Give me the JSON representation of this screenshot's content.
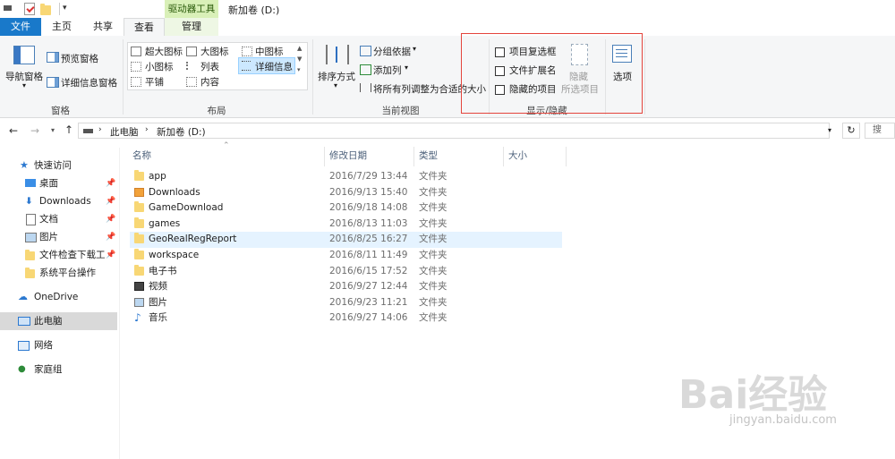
{
  "title_bar": {
    "context_tab_title": "驱动器工具",
    "window_title": "新加卷 (D:)"
  },
  "tabs": {
    "file": "文件",
    "home": "主页",
    "share": "共享",
    "view": "查看",
    "manage": "管理"
  },
  "ribbon": {
    "panes": {
      "nav_pane": "导航窗格",
      "preview_pane": "预览窗格",
      "details_pane": "详细信息窗格",
      "group_label": "窗格"
    },
    "layout": {
      "extra_large": "超大图标",
      "large": "大图标",
      "medium": "中图标",
      "small": "小图标",
      "list": "列表",
      "details": "详细信息",
      "tiles": "平铺",
      "content": "内容",
      "group_label": "布局"
    },
    "current_view": {
      "sort_by": "排序方式",
      "group_by": "分组依据",
      "add_columns": "添加列",
      "size_all_columns": "将所有列调整为合适的大小",
      "group_label": "当前视图"
    },
    "show_hide": {
      "item_checkboxes": "项目复选框",
      "file_extensions": "文件扩展名",
      "hidden_items": "隐藏的项目",
      "hide_selected_1": "隐藏",
      "hide_selected_2": "所选项目",
      "group_label": "显示/隐藏"
    },
    "options": "选项"
  },
  "address_bar": {
    "crumbs": [
      "此电脑",
      "新加卷 (D:)"
    ],
    "search_placeholder": "搜索\"新"
  },
  "nav_pane": {
    "quick_access": "快速访问",
    "pinned": [
      {
        "label": "桌面"
      },
      {
        "label": "Downloads"
      },
      {
        "label": "文档"
      },
      {
        "label": "图片"
      },
      {
        "label": "文件检查下载工具"
      },
      {
        "label": "系统平台操作"
      }
    ],
    "onedrive": "OneDrive",
    "this_pc": "此电脑",
    "network": "网络",
    "homegroup": "家庭组"
  },
  "columns": {
    "name": "名称",
    "date": "修改日期",
    "type": "类型",
    "size": "大小"
  },
  "files": [
    {
      "name": "app",
      "date": "2016/7/29 13:44",
      "type": "文件夹",
      "icon": "folder-icon"
    },
    {
      "name": "Downloads",
      "date": "2016/9/13 15:40",
      "type": "文件夹",
      "icon": "special-folder-icon"
    },
    {
      "name": "GameDownload",
      "date": "2016/9/18 14:08",
      "type": "文件夹",
      "icon": "folder-icon"
    },
    {
      "name": "games",
      "date": "2016/8/13 11:03",
      "type": "文件夹",
      "icon": "folder-icon"
    },
    {
      "name": "GeoRealRegReport",
      "date": "2016/8/25 16:27",
      "type": "文件夹",
      "icon": "folder-icon"
    },
    {
      "name": "workspace",
      "date": "2016/8/11 11:49",
      "type": "文件夹",
      "icon": "folder-icon"
    },
    {
      "name": "电子书",
      "date": "2016/6/15 17:52",
      "type": "文件夹",
      "icon": "folder-icon"
    },
    {
      "name": "视频",
      "date": "2016/9/27 12:44",
      "type": "文件夹",
      "icon": "video-folder-icon"
    },
    {
      "name": "图片",
      "date": "2016/9/23 11:21",
      "type": "文件夹",
      "icon": "pictures-folder-icon"
    },
    {
      "name": "音乐",
      "date": "2016/9/27 14:06",
      "type": "文件夹",
      "icon": "music-folder-icon"
    }
  ],
  "watermark": {
    "brand": "Bai经验",
    "url": "jingyan.baidu.com"
  },
  "colors": {
    "file_tab": "#1979ca",
    "selection": "#e5f3ff",
    "highlight_box": "#e4443c",
    "context_tab": "#d9f0b8"
  }
}
